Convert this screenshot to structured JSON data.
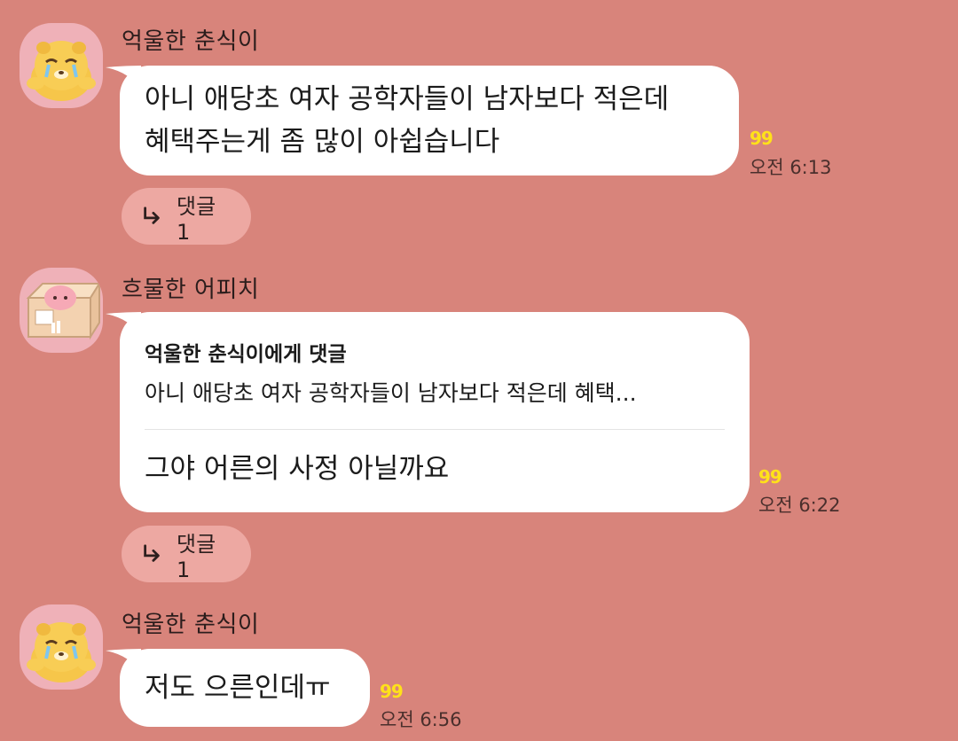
{
  "messages": [
    {
      "sender": "억울한 춘식이",
      "lines": [
        "아니 애당초 여자 공학자들이 남자보다 적은데",
        "혜택주는게 좀 많이 아쉽습니다"
      ],
      "unread": "99",
      "time": "오전 6:13",
      "reply_label": "댓글 1",
      "avatar": "choonsik-crying-avatar"
    },
    {
      "sender": "흐물한 어피치",
      "quote_title": "억울한 춘식이에게 댓글",
      "quote_text": "아니 애당초 여자 공학자들이 남자보다 적은데 혜택...",
      "text": "그야 어른의 사정 아닐까요",
      "unread": "99",
      "time": "오전 6:22",
      "reply_label": "댓글 1",
      "avatar": "apeach-in-box-avatar"
    },
    {
      "sender": "억울한 춘식이",
      "text": "저도 으른인데ㅠ",
      "unread": "99",
      "time": "오전 6:56",
      "avatar": "choonsik-crying-avatar"
    }
  ],
  "colors": {
    "background": "#d8847b",
    "bubble": "#ffffff",
    "unread": "#ffe11a",
    "chip": "#eda8a2",
    "avatar_bg": "#efb1b8"
  },
  "icons": [
    "reply-arrow-icon"
  ]
}
